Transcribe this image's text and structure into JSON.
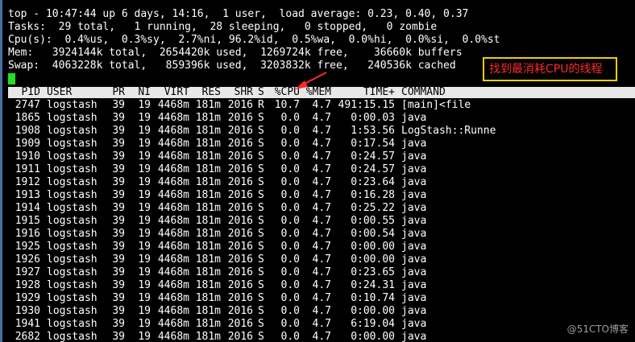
{
  "summary": {
    "line1": "top - 10:47:44 up 6 days, 14:16,  1 user,  load average: 0.23, 0.40, 0.37",
    "line2": "Tasks:  29 total,   1 running,  28 sleeping,   0 stopped,   0 zombie",
    "line3": "Cpu(s):  0.4%us,  0.3%sy,  2.7%ni, 96.2%id,  0.5%wa,  0.0%hi,  0.0%si,  0.0%st",
    "line4": "Mem:   3924144k total,  2654420k used,  1269724k free,    36660k buffers",
    "line5": "Swap:  4063228k total,   859396k used,  3203832k free,   240536k cached"
  },
  "columns": [
    "PID",
    "USER",
    "PR",
    "NI",
    "VIRT",
    "RES",
    "SHR",
    "S",
    "%CPU",
    "%MEM",
    "TIME+",
    "COMMAND"
  ],
  "processes": [
    {
      "pid": "2747",
      "user": "logstash",
      "pr": "39",
      "ni": "19",
      "virt": "4468m",
      "res": "181m",
      "shr": "2016",
      "s": "R",
      "cpu": "10.7",
      "mem": "4.7",
      "time": "491:15.15",
      "command": "[main]<file"
    },
    {
      "pid": "1865",
      "user": "logstash",
      "pr": "39",
      "ni": "19",
      "virt": "4468m",
      "res": "181m",
      "shr": "2016",
      "s": "S",
      "cpu": "0.0",
      "mem": "4.7",
      "time": "0:00.03",
      "command": "java"
    },
    {
      "pid": "1908",
      "user": "logstash",
      "pr": "39",
      "ni": "19",
      "virt": "4468m",
      "res": "181m",
      "shr": "2016",
      "s": "S",
      "cpu": "0.0",
      "mem": "4.7",
      "time": "1:53.56",
      "command": "LogStash::Runne"
    },
    {
      "pid": "1909",
      "user": "logstash",
      "pr": "39",
      "ni": "19",
      "virt": "4468m",
      "res": "181m",
      "shr": "2016",
      "s": "S",
      "cpu": "0.0",
      "mem": "4.7",
      "time": "0:17.54",
      "command": "java"
    },
    {
      "pid": "1910",
      "user": "logstash",
      "pr": "39",
      "ni": "19",
      "virt": "4468m",
      "res": "181m",
      "shr": "2016",
      "s": "S",
      "cpu": "0.0",
      "mem": "4.7",
      "time": "0:24.57",
      "command": "java"
    },
    {
      "pid": "1911",
      "user": "logstash",
      "pr": "39",
      "ni": "19",
      "virt": "4468m",
      "res": "181m",
      "shr": "2016",
      "s": "S",
      "cpu": "0.0",
      "mem": "4.7",
      "time": "0:24.57",
      "command": "java"
    },
    {
      "pid": "1912",
      "user": "logstash",
      "pr": "39",
      "ni": "19",
      "virt": "4468m",
      "res": "181m",
      "shr": "2016",
      "s": "S",
      "cpu": "0.0",
      "mem": "4.7",
      "time": "0:23.64",
      "command": "java"
    },
    {
      "pid": "1913",
      "user": "logstash",
      "pr": "39",
      "ni": "19",
      "virt": "4468m",
      "res": "181m",
      "shr": "2016",
      "s": "S",
      "cpu": "0.0",
      "mem": "4.7",
      "time": "0:16.28",
      "command": "java"
    },
    {
      "pid": "1914",
      "user": "logstash",
      "pr": "39",
      "ni": "19",
      "virt": "4468m",
      "res": "181m",
      "shr": "2016",
      "s": "S",
      "cpu": "0.0",
      "mem": "4.7",
      "time": "0:25.22",
      "command": "java"
    },
    {
      "pid": "1915",
      "user": "logstash",
      "pr": "39",
      "ni": "19",
      "virt": "4468m",
      "res": "181m",
      "shr": "2016",
      "s": "S",
      "cpu": "0.0",
      "mem": "4.7",
      "time": "0:00.55",
      "command": "java"
    },
    {
      "pid": "1916",
      "user": "logstash",
      "pr": "39",
      "ni": "19",
      "virt": "4468m",
      "res": "181m",
      "shr": "2016",
      "s": "S",
      "cpu": "0.0",
      "mem": "4.7",
      "time": "0:00.54",
      "command": "java"
    },
    {
      "pid": "1925",
      "user": "logstash",
      "pr": "39",
      "ni": "19",
      "virt": "4468m",
      "res": "181m",
      "shr": "2016",
      "s": "S",
      "cpu": "0.0",
      "mem": "4.7",
      "time": "0:00.00",
      "command": "java"
    },
    {
      "pid": "1926",
      "user": "logstash",
      "pr": "39",
      "ni": "19",
      "virt": "4468m",
      "res": "181m",
      "shr": "2016",
      "s": "S",
      "cpu": "0.0",
      "mem": "4.7",
      "time": "0:00.00",
      "command": "java"
    },
    {
      "pid": "1927",
      "user": "logstash",
      "pr": "39",
      "ni": "19",
      "virt": "4468m",
      "res": "181m",
      "shr": "2016",
      "s": "S",
      "cpu": "0.0",
      "mem": "4.7",
      "time": "0:23.65",
      "command": "java"
    },
    {
      "pid": "1928",
      "user": "logstash",
      "pr": "39",
      "ni": "19",
      "virt": "4468m",
      "res": "181m",
      "shr": "2016",
      "s": "S",
      "cpu": "0.0",
      "mem": "4.7",
      "time": "0:24.31",
      "command": "java"
    },
    {
      "pid": "1929",
      "user": "logstash",
      "pr": "39",
      "ni": "19",
      "virt": "4468m",
      "res": "181m",
      "shr": "2016",
      "s": "S",
      "cpu": "0.0",
      "mem": "4.7",
      "time": "0:10.74",
      "command": "java"
    },
    {
      "pid": "1930",
      "user": "logstash",
      "pr": "39",
      "ni": "19",
      "virt": "4468m",
      "res": "181m",
      "shr": "2016",
      "s": "S",
      "cpu": "0.0",
      "mem": "4.7",
      "time": "0:00.00",
      "command": "java"
    },
    {
      "pid": "1941",
      "user": "logstash",
      "pr": "39",
      "ni": "19",
      "virt": "4468m",
      "res": "181m",
      "shr": "2016",
      "s": "S",
      "cpu": "0.0",
      "mem": "4.7",
      "time": "6:19.04",
      "command": "java"
    },
    {
      "pid": "2682",
      "user": "logstash",
      "pr": "39",
      "ni": "19",
      "virt": "4468m",
      "res": "181m",
      "shr": "2016",
      "s": "S",
      "cpu": "0.0",
      "mem": "4.7",
      "time": "0:00.00",
      "command": "java"
    }
  ],
  "annotation": {
    "text": "找到最消耗CPU的线程",
    "text_color": "#ff2b2b",
    "border_color": "#e8d000",
    "arrow_color": "#ff2b2b"
  },
  "watermark": "@51CTO博客",
  "colors": {
    "background": "#000000",
    "text": "#ffffff",
    "header_bg": "#e8e8e8",
    "cursor": "#22dd22"
  }
}
